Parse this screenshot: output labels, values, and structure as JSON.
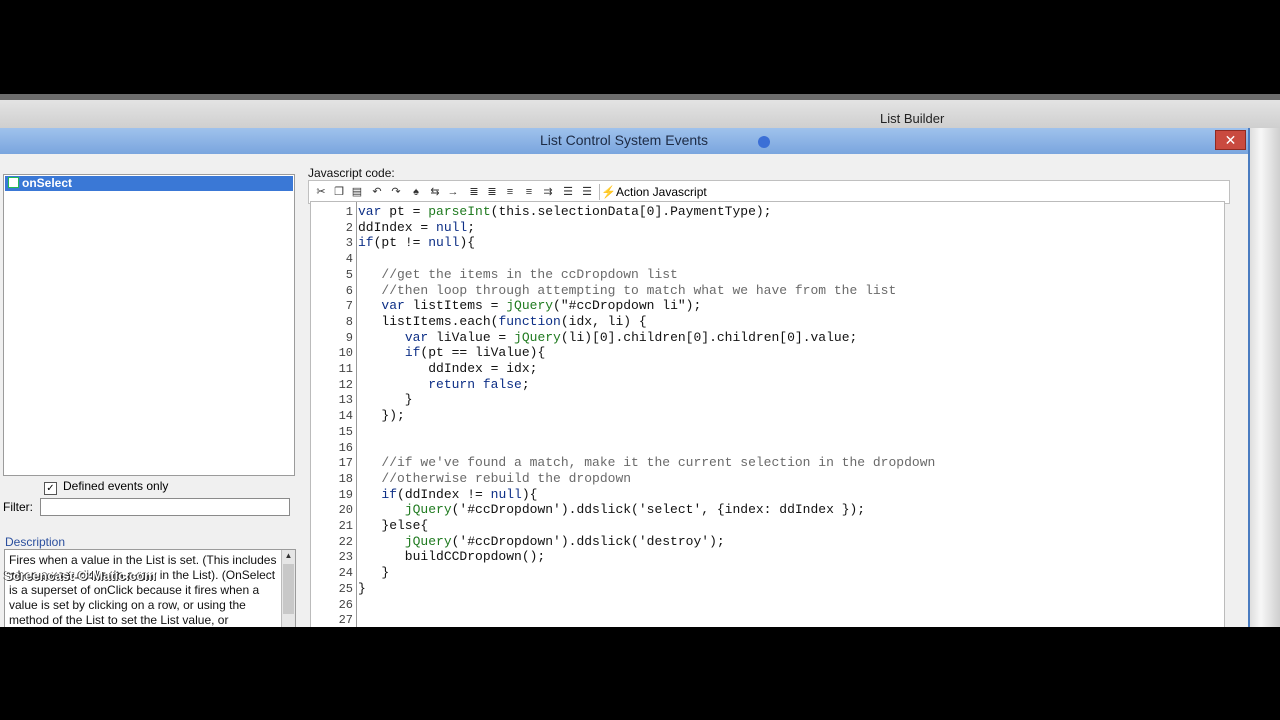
{
  "parent_window": {
    "title": "List Builder"
  },
  "dialog": {
    "title": "List Control System Events",
    "close_label": "✕"
  },
  "events_panel": {
    "items": [
      {
        "label": "onSelect"
      }
    ],
    "defined_only_label": "Defined events only",
    "defined_only_checked": true,
    "filter_label": "Filter:",
    "filter_value": ""
  },
  "description": {
    "label": "Description",
    "text": "Fires when a value in the List is set. (This includes when a user clicks on a row in the List). (OnSelect is a superset of onClick because it fires when a value is set by clicking on a row, or using the method of the List to set the List value, or"
  },
  "editor": {
    "label": "Javascript code:",
    "toolbar_icons": [
      "cut-icon",
      "copy-icon",
      "paste-icon",
      "undo-icon",
      "redo-icon",
      "find-icon",
      "replace-icon",
      "goto-icon",
      "indent-icon",
      "outdent-icon",
      "align-left-icon",
      "align-right-icon",
      "format-icon",
      "comment-icon",
      "uncomment-icon"
    ],
    "action_label": "Action Javascript",
    "lines": [
      "var pt = parseInt(this.selectionData[0].PaymentType);",
      "ddIndex = null;",
      "if(pt != null){",
      "",
      "   //get the items in the ccDropdown list",
      "   //then loop through attempting to match what we have from the list",
      "   var listItems = jQuery(\"#ccDropdown li\");",
      "   listItems.each(function(idx, li) {",
      "      var liValue = jQuery(li)[0].children[0].children[0].value;",
      "      if(pt == liValue){",
      "         ddIndex = idx;",
      "         return false;",
      "      }",
      "   });",
      "",
      "",
      "   //if we've found a match, make it the current selection in the dropdown",
      "   //otherwise rebuild the dropdown",
      "   if(ddIndex != null){",
      "      jQuery('#ccDropdown').ddslick('select', {index: ddIndex });",
      "   }else{",
      "      jQuery('#ccDropdown').ddslick('destroy');",
      "      buildCCDropdown();",
      "   }",
      "}",
      "",
      ""
    ],
    "line_numbers": [
      "1",
      "2",
      "3",
      "4",
      "5",
      "6",
      "7",
      "8",
      "9",
      "10",
      "11",
      "12",
      "13",
      "14",
      "15",
      "16",
      "17",
      "18",
      "19",
      "20",
      "21",
      "22",
      "23",
      "24",
      "25",
      "26",
      "27"
    ]
  },
  "watermark": "Screencast-O-Matic.com"
}
